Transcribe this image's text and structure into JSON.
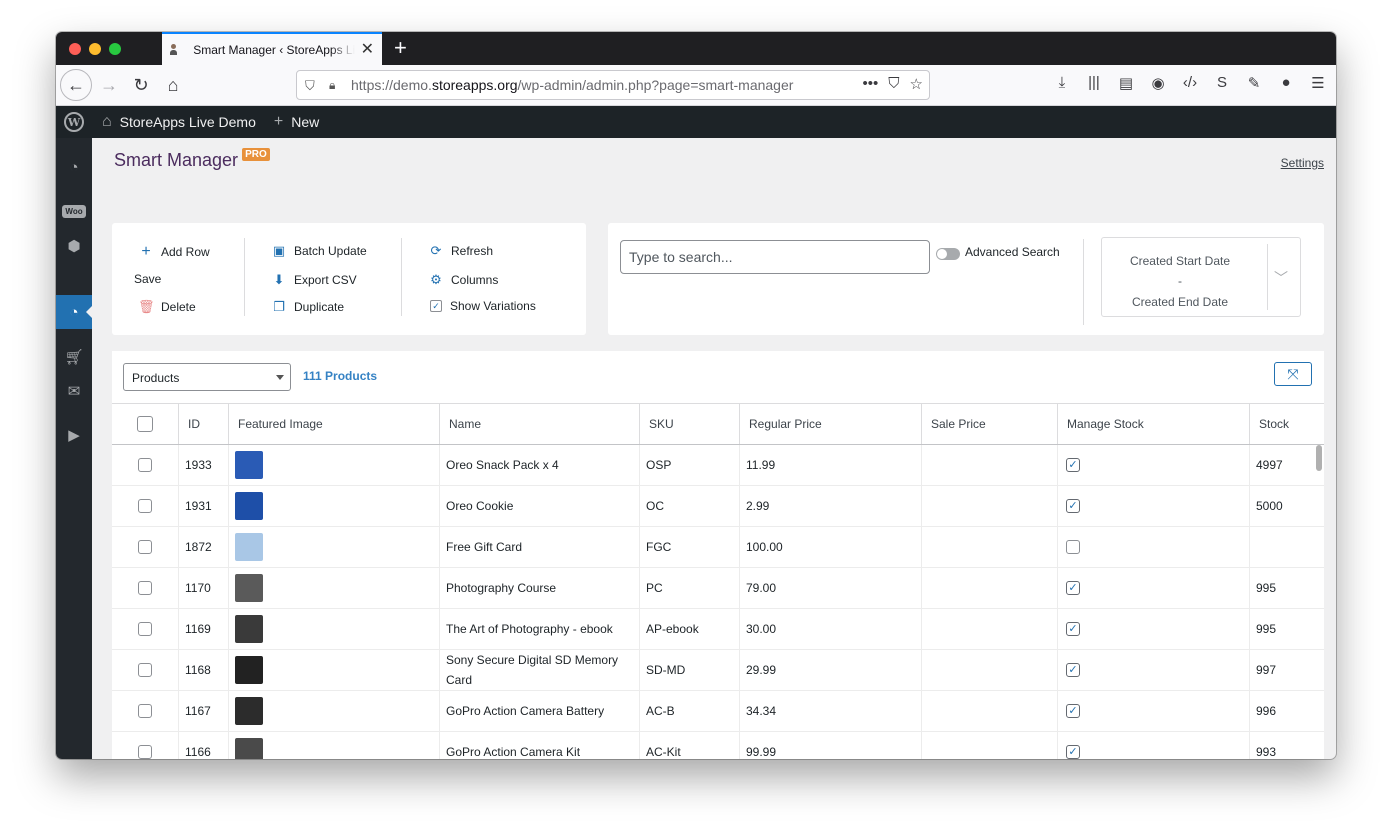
{
  "browser": {
    "tab_title": "Smart Manager ‹ StoreApps Live Demo — WordPress",
    "url_prefix": "https://demo.",
    "url_domain": "storeapps.org",
    "url_path": "/wp-admin/admin.php?page=smart-manager"
  },
  "adminbar": {
    "site_name": "StoreApps Live Demo",
    "new_label": "New"
  },
  "page": {
    "title": "Smart Manager",
    "pro_badge": "PRO",
    "settings_link": "Settings"
  },
  "actions": {
    "add_row": "Add Row",
    "save": "Save",
    "delete": "Delete",
    "batch_update": "Batch Update",
    "export_csv": "Export CSV",
    "duplicate": "Duplicate",
    "refresh": "Refresh",
    "columns": "Columns",
    "show_variations": "Show Variations"
  },
  "search": {
    "placeholder": "Type to search...",
    "advanced_label": "Advanced Search",
    "date_start": "Created Start Date",
    "date_dash": "-",
    "date_end": "Created End Date"
  },
  "grid": {
    "entity": "Products",
    "count": "111 Products",
    "columns": [
      "ID",
      "Featured Image",
      "Name",
      "SKU",
      "Regular Price",
      "Sale Price",
      "Manage Stock",
      "Stock"
    ],
    "rows": [
      {
        "id": "1933",
        "name": "Oreo Snack Pack x 4",
        "sku": "OSP",
        "regular": "11.99",
        "sale": "",
        "manage": true,
        "stock": "4997",
        "thumb": "#2a5bb5"
      },
      {
        "id": "1931",
        "name": "Oreo Cookie",
        "sku": "OC",
        "regular": "2.99",
        "sale": "",
        "manage": true,
        "stock": "5000",
        "thumb": "#1e4fa8"
      },
      {
        "id": "1872",
        "name": "Free Gift Card",
        "sku": "FGC",
        "regular": "100.00",
        "sale": "",
        "manage": false,
        "stock": "",
        "thumb": "#a9c7e6"
      },
      {
        "id": "1170",
        "name": "Photography Course",
        "sku": "PC",
        "regular": "79.00",
        "sale": "",
        "manage": true,
        "stock": "995",
        "thumb": "#5a5a5a"
      },
      {
        "id": "1169",
        "name": "The Art of Photography - ebook",
        "sku": "AP-ebook",
        "regular": "30.00",
        "sale": "",
        "manage": true,
        "stock": "995",
        "thumb": "#3a3a3a"
      },
      {
        "id": "1168",
        "name": "Sony Secure Digital SD Memory Card",
        "sku": "SD-MD",
        "regular": "29.99",
        "sale": "",
        "manage": true,
        "stock": "997",
        "thumb": "#222222"
      },
      {
        "id": "1167",
        "name": "GoPro Action Camera Battery",
        "sku": "AC-B",
        "regular": "34.34",
        "sale": "",
        "manage": true,
        "stock": "996",
        "thumb": "#2c2c2c"
      },
      {
        "id": "1166",
        "name": "GoPro Action Camera Kit",
        "sku": "AC-Kit",
        "regular": "99.99",
        "sale": "",
        "manage": true,
        "stock": "993",
        "thumb": "#4a4a4a"
      },
      {
        "id": "",
        "name": "",
        "sku": "",
        "regular": "",
        "sale": "",
        "manage": true,
        "stock": "",
        "thumb": "#333333"
      }
    ]
  }
}
